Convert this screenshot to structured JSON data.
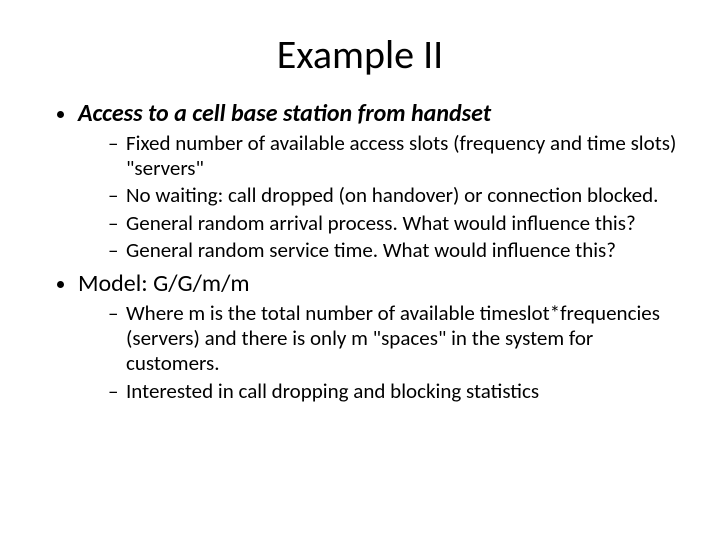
{
  "title": "Example II",
  "bullets": [
    {
      "text": "Access to a cell base station from handset",
      "style": "heading",
      "sub": [
        "Fixed number of available access slots (frequency and time slots) \"servers\"",
        "No waiting: call dropped (on handover) or connection blocked.",
        "General random arrival process. What would influence this?",
        "General random service time. What would influence this?"
      ]
    },
    {
      "text": "Model: G/G/m/m",
      "style": "plain",
      "sub": [
        "Where m is the total number of available timeslot*frequencies (servers) and there is only m \"spaces\" in the system for customers.",
        "Interested in call dropping and blocking statistics"
      ]
    }
  ]
}
